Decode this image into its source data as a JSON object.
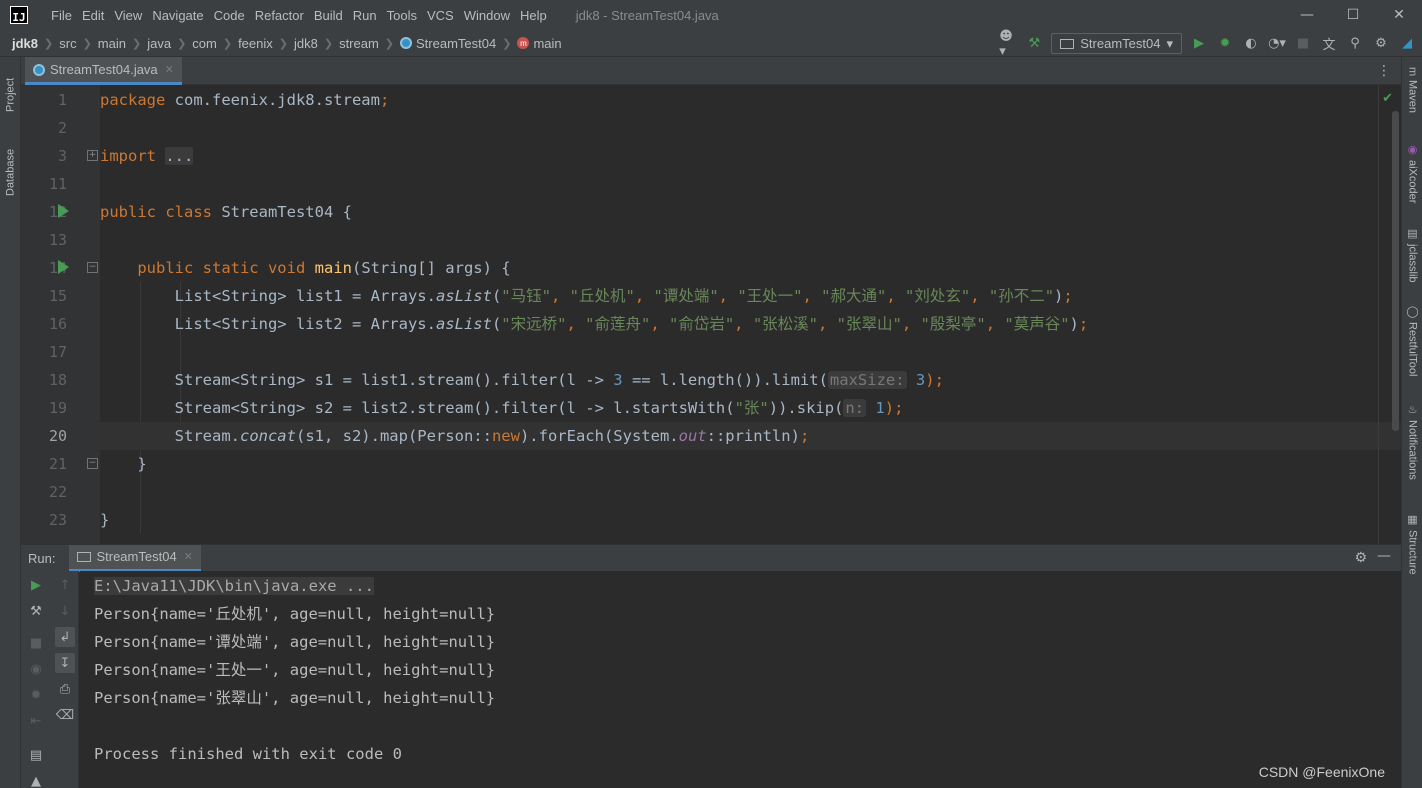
{
  "app": {
    "logo_text": "IJ",
    "window_title": "jdk8 - StreamTest04.java",
    "menu": [
      "File",
      "Edit",
      "View",
      "Navigate",
      "Code",
      "Refactor",
      "Build",
      "Run",
      "Tools",
      "VCS",
      "Window",
      "Help"
    ]
  },
  "breadcrumb": [
    "jdk8",
    "src",
    "main",
    "java",
    "com",
    "feenix",
    "jdk8",
    "stream",
    "StreamTest04",
    "main"
  ],
  "toolbar": {
    "run_config": "StreamTest04"
  },
  "left_tabs": [
    "Project",
    "Database"
  ],
  "right_tabs": [
    "Maven",
    "aiXcoder",
    "jclasslib",
    "RestfulTool",
    "Notifications",
    "Structure"
  ],
  "editor": {
    "file_tab": "StreamTest04.java",
    "current_line": "20",
    "lines": [
      {
        "no": "1"
      },
      {
        "no": "2"
      },
      {
        "no": "3"
      },
      {
        "no": "11"
      },
      {
        "no": "12"
      },
      {
        "no": "13"
      },
      {
        "no": "14"
      },
      {
        "no": "15"
      },
      {
        "no": "16"
      },
      {
        "no": "17"
      },
      {
        "no": "18"
      },
      {
        "no": "19"
      },
      {
        "no": "20"
      },
      {
        "no": "21"
      },
      {
        "no": "22"
      },
      {
        "no": "23"
      }
    ],
    "tokens": {
      "pkg_kw": "package",
      "pkg_name": " com.feenix.jdk8.stream",
      "semi": ";",
      "import_kw": "import",
      "import_fold": "...",
      "class_decl_kw": "public class",
      "class_name": " StreamTest04 {",
      "method_kw": "public static void",
      "method_name": "main",
      "method_params": "(String[] args) {",
      "l15_a": "List<String> list1 = Arrays.",
      "l15_fn": "asList",
      "l15_s": [
        "\"马钰\"",
        "\"丘处机\"",
        "\"谭处端\"",
        "\"王处一\"",
        "\"郝大通\"",
        "\"刘处玄\"",
        "\"孙不二\""
      ],
      "l16_a": "List<String> list2 = Arrays.",
      "l16_s": [
        "\"宋远桥\"",
        "\"俞莲舟\"",
        "\"俞岱岩\"",
        "\"张松溪\"",
        "\"张翠山\"",
        "\"殷梨亭\"",
        "\"莫声谷\""
      ],
      "l18_a": "Stream<String> s1 = list1.stream().filter(l -> ",
      "l18_num": "3",
      "l18_b": " == l.length()).limit(",
      "l18_hint": "maxSize:",
      "l18_num2": "3",
      "l18_end": ");",
      "l19_a": "Stream<String> s2 = list2.stream().filter(l -> l.startsWith(",
      "l19_str": "\"张\"",
      "l19_b": ")).skip(",
      "l19_hint": "n:",
      "l19_num": "1",
      "l19_end": ");",
      "l20_a": "Stream.",
      "l20_fn": "concat",
      "l20_b": "(s1",
      "l20_c": ", s2).map(Person::",
      "l20_new": "new",
      "l20_d": ").forEach(System.",
      "l20_out": "out",
      "l20_e": "::println)",
      "l20_end": ";",
      "close_brace_method": "}",
      "close_brace_class": "}",
      "comma": ", ",
      "lparen": "(",
      "rparen": ")"
    }
  },
  "run_panel": {
    "title": "Run:",
    "tab": "StreamTest04",
    "console": [
      "E:\\Java11\\JDK\\bin\\java.exe ...",
      "Person{name='丘处机', age=null, height=null}",
      "Person{name='谭处端', age=null, height=null}",
      "Person{name='王处一', age=null, height=null}",
      "Person{name='张翠山', age=null, height=null}",
      "",
      "Process finished with exit code 0"
    ]
  },
  "watermark": "CSDN @FeenixOne"
}
